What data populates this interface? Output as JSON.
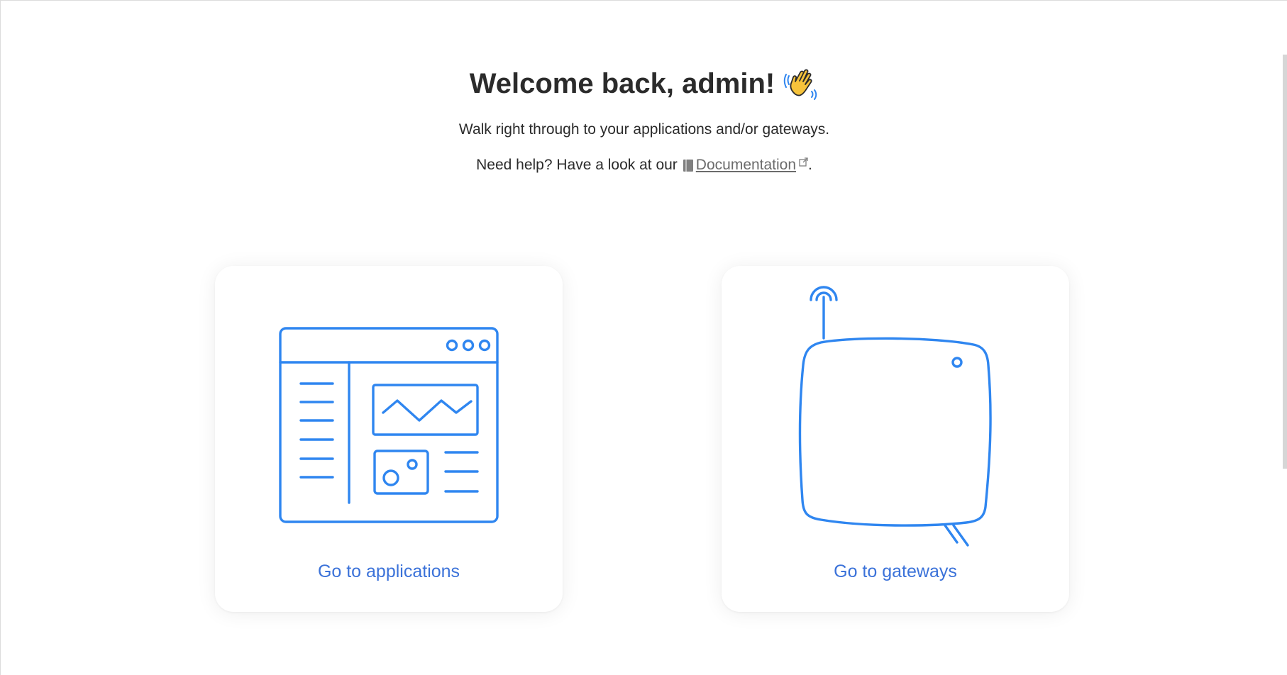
{
  "header": {
    "title": "Welcome back, admin!",
    "wave_emoji": "👋",
    "subtitle": "Walk right through to your applications and/or gateways.",
    "help_prefix": "Need help? Have a look at our",
    "doc_link_label": "Documentation",
    "help_suffix": "."
  },
  "cards": {
    "applications": {
      "label": "Go to applications",
      "icon": "application-dashboard-icon"
    },
    "gateways": {
      "label": "Go to gateways",
      "icon": "gateway-device-icon"
    }
  },
  "colors": {
    "accent": "#3b72d9",
    "illustration_stroke": "#2f86f0",
    "title_text": "#2b2b2b",
    "doc_link": "#6b6b6b"
  }
}
